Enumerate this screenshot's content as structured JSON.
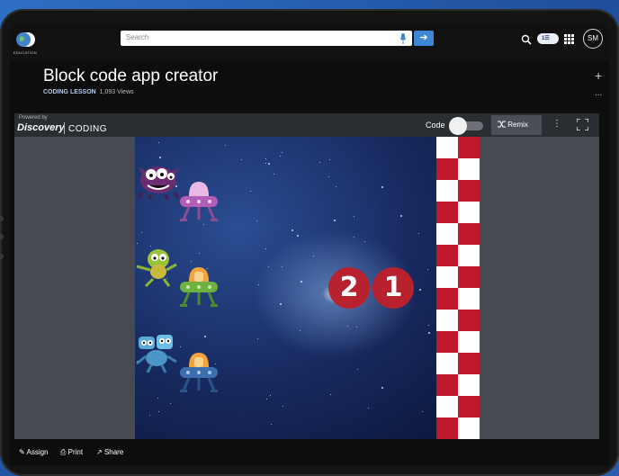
{
  "header": {
    "logo_text": "EDUCATION",
    "search_placeholder": "Search",
    "go_arrow": "➔",
    "pill_text": "1☰",
    "avatar_initials": "SM"
  },
  "lesson": {
    "title": "Block code app creator",
    "kind": "CODING LESSON",
    "views": "1,093 Views",
    "plus": "+",
    "more": "..."
  },
  "app": {
    "powered_by": "Powered by",
    "brand": "Discovery",
    "brand_sub": "EDUCATION",
    "coding_label": "CODING",
    "code_label": "Code",
    "remix_label": "Remix",
    "kebab": "⋮"
  },
  "stage": {
    "countdown": [
      "2",
      "1"
    ],
    "colors": {
      "finish_red": "#c0182b",
      "finish_white": "#ffffff",
      "countdown": "#b8222f"
    },
    "racers": [
      {
        "monster": "purple-monster",
        "ufo": "purple-ufo"
      },
      {
        "monster": "green-monster",
        "ufo": "green-ufo"
      },
      {
        "monster": "blue-monster",
        "ufo": "blue-ufo"
      }
    ]
  },
  "actions": [
    {
      "icon": "assign-icon",
      "label": "Assign"
    },
    {
      "icon": "print-icon",
      "label": "Print"
    },
    {
      "icon": "share-icon",
      "label": "Share"
    }
  ]
}
